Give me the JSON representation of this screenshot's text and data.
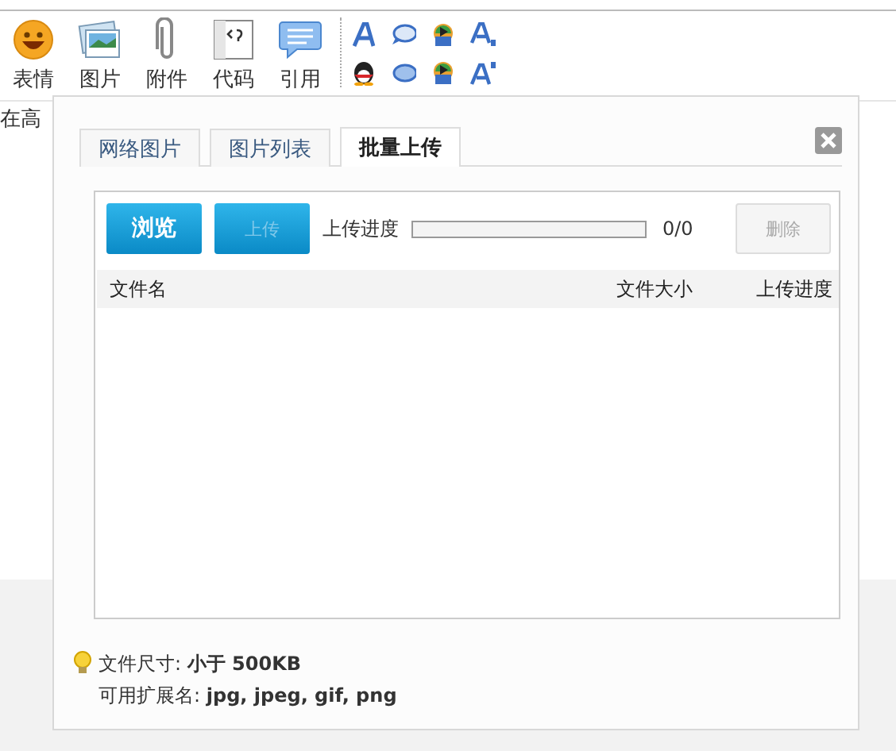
{
  "toolbar": {
    "buttons": [
      {
        "label": "表情",
        "kind": "emoji"
      },
      {
        "label": "图片",
        "kind": "image"
      },
      {
        "label": "附件",
        "kind": "attachment"
      },
      {
        "label": "代码",
        "kind": "code"
      },
      {
        "label": "引用",
        "kind": "quote"
      }
    ]
  },
  "background_text": "在高",
  "dialog": {
    "tabs": [
      {
        "label": "网络图片",
        "selected": false
      },
      {
        "label": "图片列表",
        "selected": false
      },
      {
        "label": "批量上传",
        "selected": true
      }
    ],
    "actions": [
      {
        "label": "浏览",
        "kind": "primary",
        "disabled": false
      },
      {
        "label": "上传",
        "kind": "primary",
        "disabled": true
      }
    ],
    "progress": {
      "label": "上传进度",
      "level": 0,
      "reading": "0/0"
    },
    "delete_button": {
      "label": "删除",
      "disabled": true
    },
    "table": {
      "columns": [
        "文件名",
        "文件大小",
        "上传进度"
      ]
    },
    "tips": [
      {
        "label": "文件尺寸: ",
        "value": "小于 500KB"
      },
      {
        "label": "可用扩展名: ",
        "value": "jpg, jpeg, gif, png"
      }
    ]
  }
}
